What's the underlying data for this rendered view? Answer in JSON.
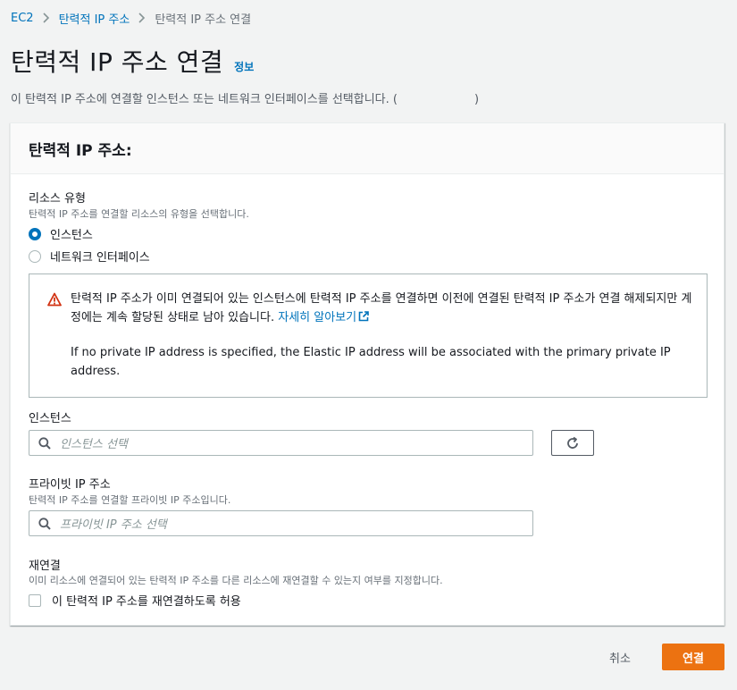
{
  "breadcrumb": {
    "items": [
      "EC2",
      "탄력적 IP 주소",
      "탄력적 IP 주소 연결"
    ]
  },
  "page": {
    "title": "탄력적 IP 주소 연결",
    "info_link": "정보",
    "description": "이 탄력적 IP 주소에 연결할 인스턴스 또는 네트워크 인터페이스를 선택합니다. (",
    "description_end": ")"
  },
  "panel": {
    "title": "탄력적 IP 주소:",
    "resource_type": {
      "label": "리소스 유형",
      "description": "탄력적 IP 주소를 연결할 리소스의 유형을 선택합니다.",
      "options": [
        "인스턴스",
        "네트워크 인터페이스"
      ],
      "selected": "인스턴스"
    },
    "alert": {
      "text": "탄력적 IP 주소가 이미 연결되어 있는 인스턴스에 탄력적 IP 주소를 연결하면 이전에 연결된 탄력적 IP 주소가 연결 해제되지만 계정에는 계속 할당된 상태로 남아 있습니다.",
      "learn_more": "자세히 알아보기",
      "text2": "If no private IP address is specified, the Elastic IP address will be associated with the primary private IP address."
    },
    "instance": {
      "label": "인스턴스",
      "placeholder": "인스턴스 선택"
    },
    "private_ip": {
      "label": "프라이빗 IP 주소",
      "description": "탄력적 IP 주소를 연결할 프라이빗 IP 주소입니다.",
      "placeholder": "프라이빗 IP 주소 선택"
    },
    "reassociation": {
      "label": "재연결",
      "description": "이미 리소스에 연결되어 있는 탄력적 IP 주소를 다른 리소스에 재연결할 수 있는지 여부를 지정합니다.",
      "checkbox_label": "이 탄력적 IP 주소를 재연결하도록 허용",
      "checked": false
    }
  },
  "footer": {
    "cancel": "취소",
    "connect": "연결"
  },
  "colors": {
    "link": "#0073bb",
    "primary_button": "#ec7211",
    "warning_icon": "#d13212"
  },
  "icons": {
    "breadcrumb_separator": "chevron-right-icon",
    "alert": "warning-icon",
    "external_link": "external-link-icon",
    "search": "search-icon",
    "refresh": "refresh-icon"
  }
}
